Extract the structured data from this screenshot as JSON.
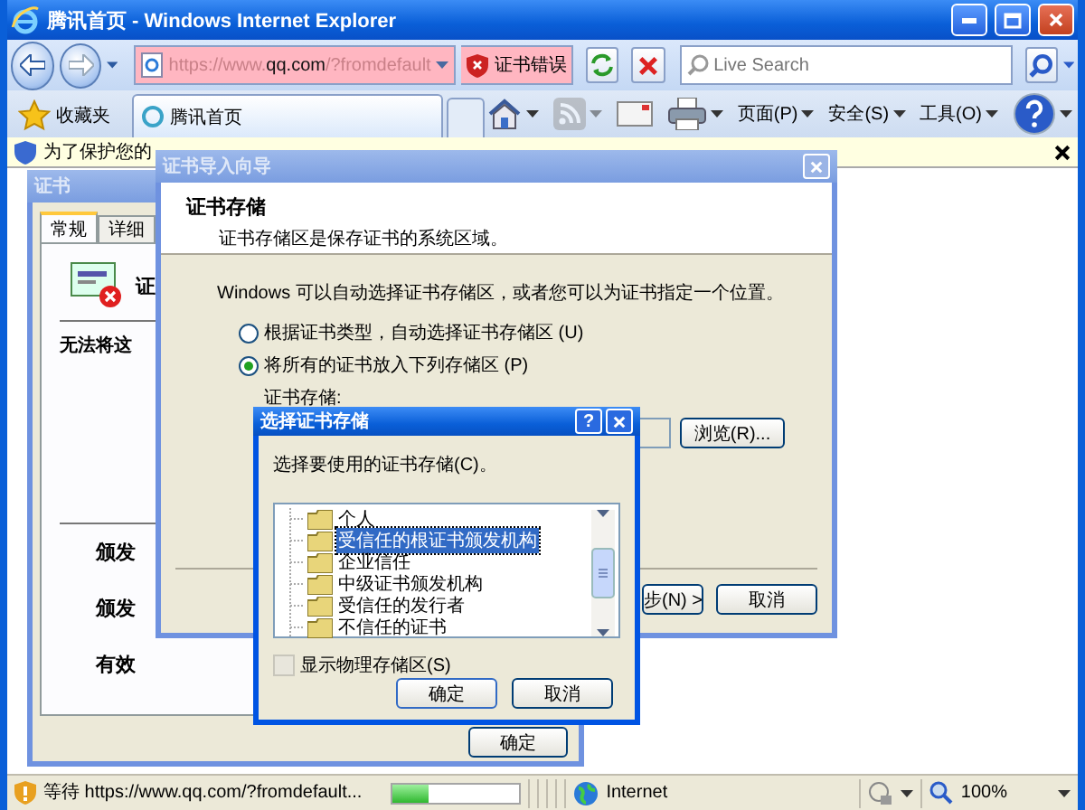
{
  "browser": {
    "title": "腾讯首页 - Windows Internet Explorer",
    "address": {
      "prefix": "https://www.",
      "host": "qq.com",
      "suffix": "/?fromdefault"
    },
    "cert_error": "证书错误",
    "search": {
      "placeholder": "Live Search"
    },
    "favorites": "收藏夹",
    "tabs": [
      {
        "label": "腾讯首页",
        "selected": true
      }
    ],
    "toolbar": [
      {
        "kind": "home",
        "disabled": false
      },
      {
        "kind": "feeds",
        "disabled": true
      },
      {
        "kind": "mail",
        "disabled": false
      },
      {
        "kind": "print",
        "disabled": false
      },
      {
        "kind": "menu",
        "label": "页面(P)"
      },
      {
        "kind": "menu",
        "label": "安全(S)"
      },
      {
        "kind": "menu",
        "label": "工具(O)"
      },
      {
        "kind": "help",
        "disabled": false
      }
    ]
  },
  "info_bar": {
    "text": "为了保护您的"
  },
  "cert_dialog": {
    "title": "证书",
    "active": false,
    "tabs": [
      {
        "label": "常规",
        "selected": true
      },
      {
        "label": "详细",
        "selected": false
      }
    ],
    "heading": "证",
    "message": "无法将这",
    "fields": [
      "颁发",
      "颁发",
      "有效"
    ],
    "ok": "确定"
  },
  "wizard": {
    "title": "证书导入向导",
    "active": false,
    "heading": "证书存储",
    "subtitle": "证书存储区是保存证书的系统区域。",
    "intro": "Windows 可以自动选择证书存储区，或者您可以为证书指定一个位置。",
    "options": [
      {
        "label": "根据证书类型，自动选择证书存储区 (U)",
        "selected": false
      },
      {
        "label": "将所有的证书放入下列存储区 (P)",
        "selected": true
      }
    ],
    "store_label": "证书存储:",
    "browse": "浏览(R)...",
    "next": "步(N) >",
    "cancel": "取消"
  },
  "store_dialog": {
    "title": "选择证书存储",
    "active": true,
    "help_button": "?",
    "prompt": "选择要使用的证书存储(C)。",
    "stores": [
      {
        "label": "个人",
        "selected": false
      },
      {
        "label": "受信任的根证书颁发机构",
        "selected": true
      },
      {
        "label": "企业信任",
        "selected": false
      },
      {
        "label": "中级证书颁发机构",
        "selected": false
      },
      {
        "label": "受信任的发行者",
        "selected": false
      },
      {
        "label": "不信任的证书",
        "selected": false
      }
    ],
    "show_physical": {
      "label": "显示物理存储区(S)",
      "checked": false
    },
    "ok": "确定",
    "cancel": "取消"
  },
  "status_bar": {
    "text": "等待 https://www.qq.com/?fromdefault...",
    "progress": {
      "level": 0.28
    },
    "zone": "Internet",
    "zoom": "100%"
  }
}
